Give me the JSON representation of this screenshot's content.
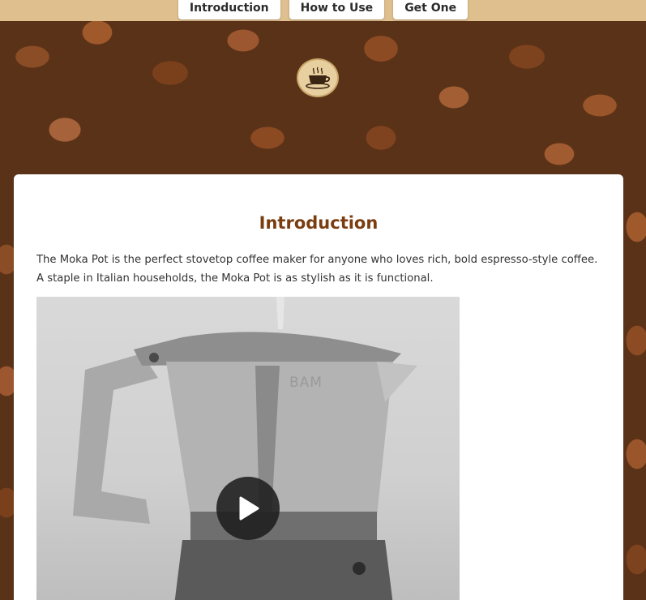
{
  "nav": {
    "items": [
      "Introduction",
      "How to Use",
      "Get One"
    ]
  },
  "logo": {
    "icon": "coffee-cup-icon"
  },
  "main": {
    "title": "Introduction",
    "intro_text": "The Moka Pot is the perfect stovetop coffee maker for anyone who loves rich, bold espresso-style coffee. A staple in Italian households, the Moka Pot is as stylish as it is functional.",
    "video": {
      "watermark": "BAM",
      "play_icon": "play-icon"
    }
  },
  "colors": {
    "nav_bar": "#dfbf8e",
    "title": "#7a3d10",
    "card": "#ffffff",
    "logo_badge": "#e7cf9f"
  }
}
